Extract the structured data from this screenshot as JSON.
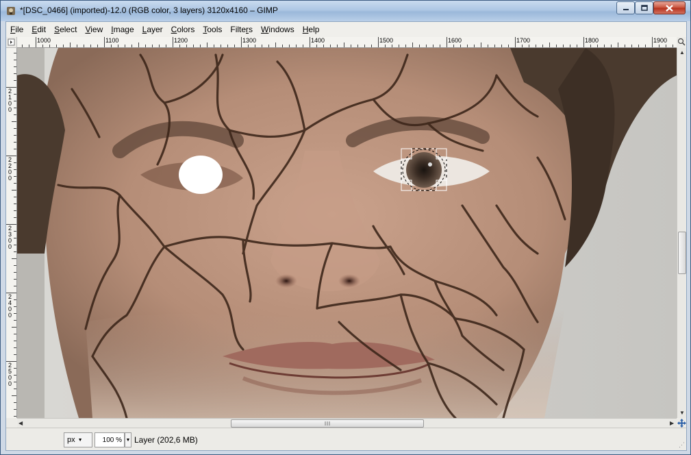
{
  "window": {
    "title": "*[DSC_0466] (imported)-12.0 (RGB color, 3 layers) 3120x4160 – GIMP",
    "icon": "gimp-icon",
    "controls": {
      "minimize": "minimize-icon",
      "maximize": "maximize-icon",
      "close": "close-icon"
    }
  },
  "menu": {
    "items": [
      {
        "label": "File",
        "accel": "F"
      },
      {
        "label": "Edit",
        "accel": "E"
      },
      {
        "label": "Select",
        "accel": "S"
      },
      {
        "label": "View",
        "accel": "V"
      },
      {
        "label": "Image",
        "accel": "I"
      },
      {
        "label": "Layer",
        "accel": "L"
      },
      {
        "label": "Colors",
        "accel": "C"
      },
      {
        "label": "Tools",
        "accel": "T"
      },
      {
        "label": "Filters",
        "accel": "r"
      },
      {
        "label": "Windows",
        "accel": "W"
      },
      {
        "label": "Help",
        "accel": "H"
      }
    ]
  },
  "rulers": {
    "horizontal_labels": [
      "1000",
      "1100",
      "1200",
      "1300",
      "1400",
      "1500",
      "1600",
      "1700",
      "1800",
      "1900"
    ],
    "vertical_labels": [
      "2100",
      "2200",
      "2300",
      "2400",
      "2500"
    ]
  },
  "statusbar": {
    "unit": "px",
    "zoom": "100 %",
    "message": "Layer (202,6 MB)"
  },
  "colors": {
    "accent": "#3b5a80",
    "crack": "#3a2418",
    "skin": "#b99582",
    "background_wall": "#cfcfcb"
  }
}
